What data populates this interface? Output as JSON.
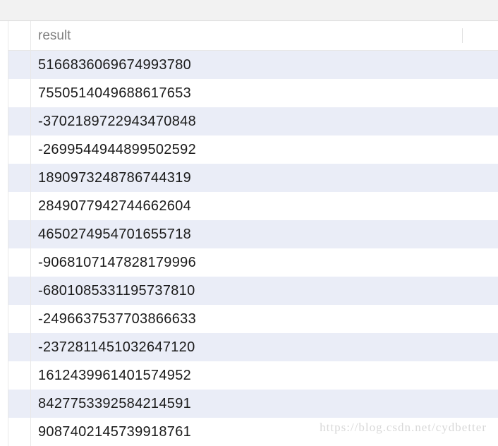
{
  "header": {
    "column_label": "result"
  },
  "rows": [
    "5166836069674993780",
    "7550514049688617653",
    "-3702189722943470848",
    "-2699544944899502592",
    "1890973248786744319",
    "2849077942744662604",
    "4650274954701655718",
    "-9068107147828179996",
    "-6801085331195737810",
    "-2496637537703866633",
    "-2372811451032647120",
    "1612439961401574952",
    "8427753392584214591",
    "9087402145739918761"
  ],
  "watermark": "https://blog.csdn.net/cydbetter"
}
